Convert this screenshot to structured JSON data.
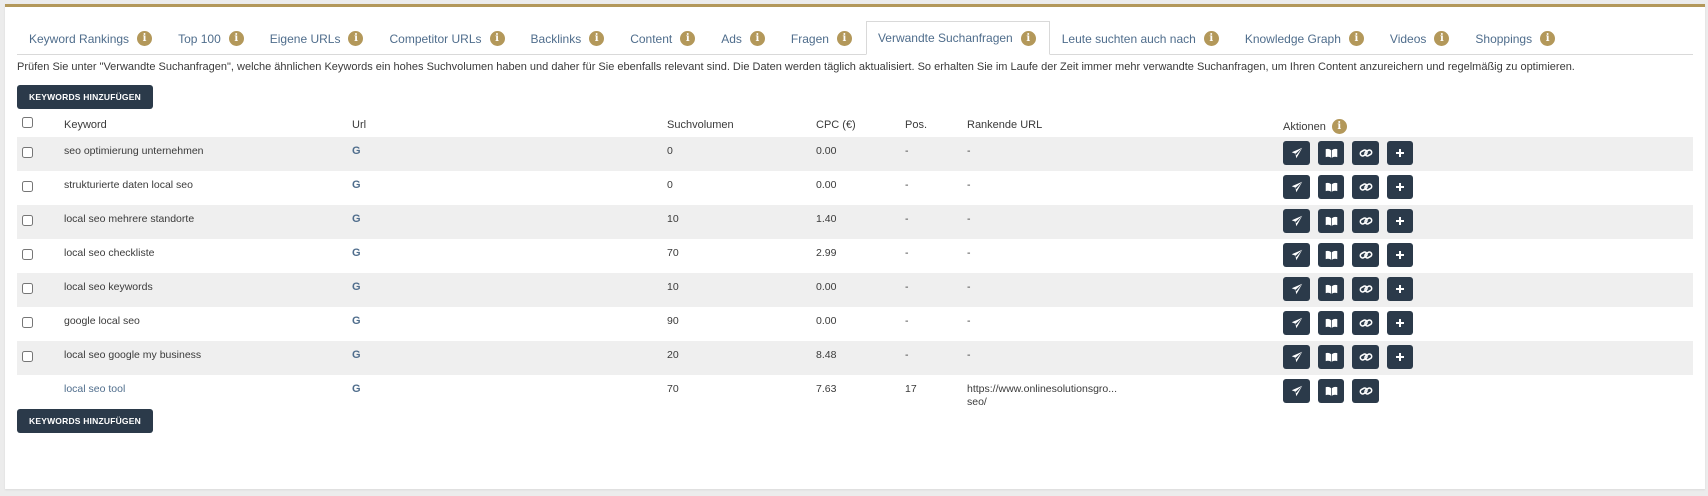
{
  "tabs": [
    {
      "label": "Keyword Rankings",
      "active": false
    },
    {
      "label": "Top 100",
      "active": false
    },
    {
      "label": "Eigene URLs",
      "active": false
    },
    {
      "label": "Competitor URLs",
      "active": false
    },
    {
      "label": "Backlinks",
      "active": false
    },
    {
      "label": "Content",
      "active": false
    },
    {
      "label": "Ads",
      "active": false
    },
    {
      "label": "Fragen",
      "active": false
    },
    {
      "label": "Verwandte Suchanfragen",
      "active": true
    },
    {
      "label": "Leute suchten auch nach",
      "active": false
    },
    {
      "label": "Knowledge Graph",
      "active": false
    },
    {
      "label": "Videos",
      "active": false
    },
    {
      "label": "Shoppings",
      "active": false
    }
  ],
  "info_glyph": "i",
  "description": "Prüfen Sie unter \"Verwandte Suchanfragen\", welche ähnlichen Keywords ein hohes Suchvolumen haben und daher für Sie ebenfalls relevant sind. Die Daten werden täglich aktualisiert. So erhalten Sie im Laufe der Zeit immer mehr verwandte Suchanfragen, um Ihren Content anzureichern und regelmäßig zu optimieren.",
  "add_keywords_label": "KEYWORDS HINZUFÜGEN",
  "google_glyph": "G",
  "table": {
    "headers": {
      "keyword": "Keyword",
      "url": "Url",
      "volume": "Suchvolumen",
      "cpc": "CPC (€)",
      "pos": "Pos.",
      "ranking_url": "Rankende URL",
      "actions": "Aktionen"
    },
    "rows": [
      {
        "keyword": "seo optimierung unternehmen",
        "volume": "0",
        "cpc": "0.00",
        "pos": "-",
        "ranking_url": "-",
        "ranking_url_2": "",
        "checkbox": true,
        "linked": false,
        "add": true
      },
      {
        "keyword": "strukturierte daten local seo",
        "volume": "0",
        "cpc": "0.00",
        "pos": "-",
        "ranking_url": "-",
        "ranking_url_2": "",
        "checkbox": true,
        "linked": false,
        "add": true
      },
      {
        "keyword": "local seo mehrere standorte",
        "volume": "10",
        "cpc": "1.40",
        "pos": "-",
        "ranking_url": "-",
        "ranking_url_2": "",
        "checkbox": true,
        "linked": false,
        "add": true
      },
      {
        "keyword": "local seo checkliste",
        "volume": "70",
        "cpc": "2.99",
        "pos": "-",
        "ranking_url": "-",
        "ranking_url_2": "",
        "checkbox": true,
        "linked": false,
        "add": true
      },
      {
        "keyword": "local seo keywords",
        "volume": "10",
        "cpc": "0.00",
        "pos": "-",
        "ranking_url": "-",
        "ranking_url_2": "",
        "checkbox": true,
        "linked": false,
        "add": true
      },
      {
        "keyword": "google local seo",
        "volume": "90",
        "cpc": "0.00",
        "pos": "-",
        "ranking_url": "-",
        "ranking_url_2": "",
        "checkbox": true,
        "linked": false,
        "add": true
      },
      {
        "keyword": "local seo google my business",
        "volume": "20",
        "cpc": "8.48",
        "pos": "-",
        "ranking_url": "-",
        "ranking_url_2": "",
        "checkbox": true,
        "linked": false,
        "add": true
      },
      {
        "keyword": "local seo tool",
        "volume": "70",
        "cpc": "7.63",
        "pos": "17",
        "ranking_url": "https://www.onlinesolutionsgro...",
        "ranking_url_2": "seo/",
        "checkbox": false,
        "linked": true,
        "add": false
      }
    ]
  },
  "colors": {
    "accent_gold": "#b3985a",
    "dark_button": "#2b3a4a",
    "link_blue": "#4f6d8c",
    "row_alt": "#efefef"
  },
  "action_icons": [
    "paper-plane-icon",
    "book-icon",
    "link-icon",
    "plus-icon"
  ]
}
